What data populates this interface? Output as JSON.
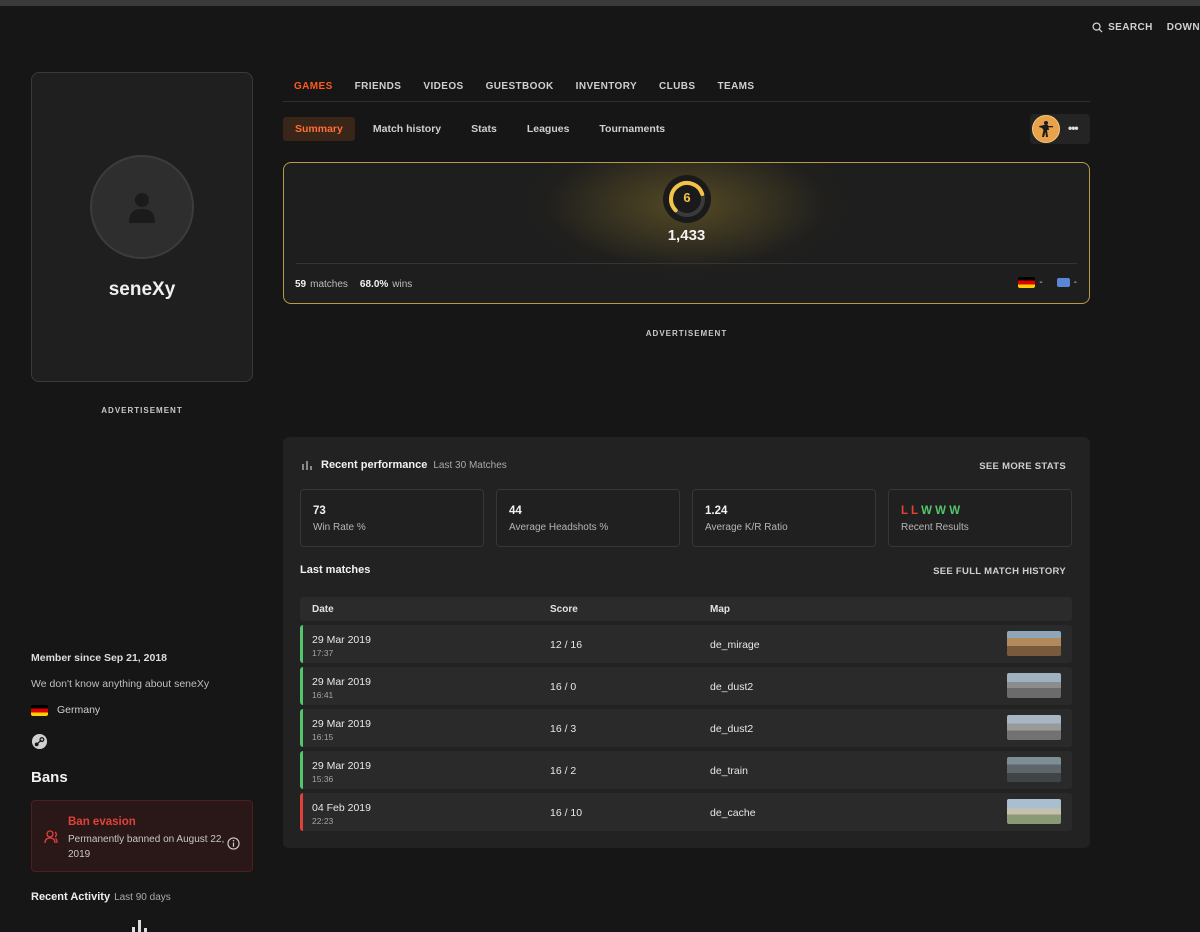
{
  "top": {
    "search_label": "SEARCH",
    "download_label": "DOWN"
  },
  "profile": {
    "username": "seneXy",
    "ad_label": "ADVERTISEMENT"
  },
  "about": {
    "member_since": "Member since Sep 21, 2018",
    "bio": "We don't know anything about seneXy",
    "country": "Germany"
  },
  "bans": {
    "title": "Bans",
    "ban_title": "Ban evasion",
    "ban_desc": "Permanently banned on August 22, 2019"
  },
  "activity": {
    "title": "Recent Activity",
    "sub": "Last 90 days"
  },
  "main_tabs": [
    "GAMES",
    "FRIENDS",
    "VIDEOS",
    "GUESTBOOK",
    "INVENTORY",
    "CLUBS",
    "TEAMS"
  ],
  "sub_tabs": [
    "Summary",
    "Match history",
    "Stats",
    "Leagues",
    "Tournaments"
  ],
  "elo": {
    "level": "6",
    "level_fraction": 0.6,
    "value": "1,433",
    "matches": "59",
    "matches_label": "matches",
    "wins": "68.0%",
    "wins_label": "wins",
    "country_rank": "-",
    "region_rank": "-",
    "accent": "#f3c248"
  },
  "ad_main": "ADVERTISEMENT",
  "performance": {
    "title": "Recent performance",
    "sub": "Last 30 Matches",
    "see_more": "SEE MORE STATS",
    "stats": [
      {
        "value": "73",
        "label": "Win Rate %"
      },
      {
        "value": "44",
        "label": "Average Headshots %"
      },
      {
        "value": "1.24",
        "label": "Average K/R Ratio"
      }
    ],
    "recent_results": [
      "L",
      "L",
      "W",
      "W",
      "W"
    ],
    "recent_results_label": "Recent Results",
    "win_color": "#53c56a",
    "loss_color": "#e0423a"
  },
  "matches": {
    "title": "Last matches",
    "see_full": "SEE FULL MATCH HISTORY",
    "headers": {
      "date": "Date",
      "score": "Score",
      "map": "Map"
    },
    "rows": [
      {
        "date": "29 Mar 2019",
        "time": "17:37",
        "score": "12 / 16",
        "map": "de_mirage",
        "result": "win"
      },
      {
        "date": "29 Mar 2019",
        "time": "16:41",
        "score": "16 / 0",
        "map": "de_dust2",
        "result": "win"
      },
      {
        "date": "29 Mar 2019",
        "time": "16:15",
        "score": "16 / 3",
        "map": "de_dust2",
        "result": "win"
      },
      {
        "date": "29 Mar 2019",
        "time": "15:36",
        "score": "16 / 2",
        "map": "de_train",
        "result": "win"
      },
      {
        "date": "04 Feb 2019",
        "time": "22:23",
        "score": "16 / 10",
        "map": "de_cache",
        "result": "loss"
      }
    ]
  }
}
